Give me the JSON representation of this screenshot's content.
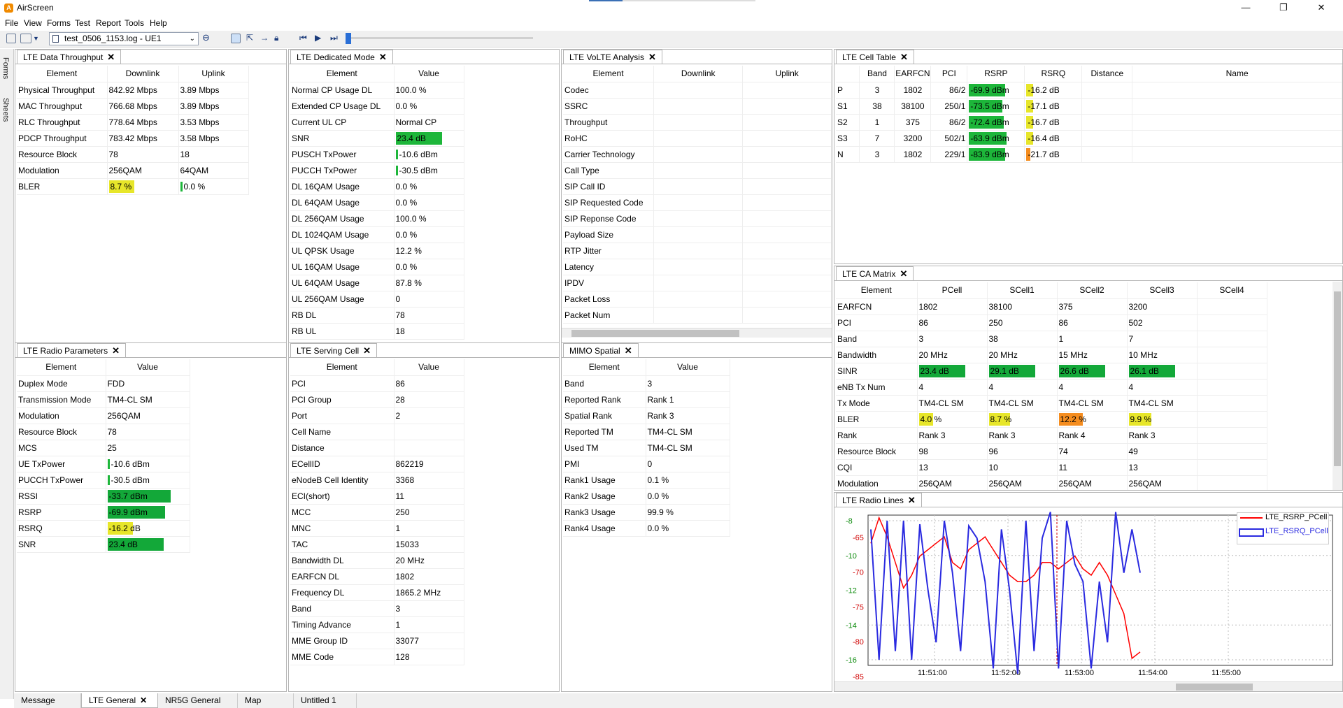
{
  "app": {
    "title": "AirScreen"
  },
  "window": {
    "minimize": "—",
    "restore": "❐",
    "close": "✕"
  },
  "menu": [
    "File",
    "View",
    "Forms",
    "Test",
    "Report",
    "Tools",
    "Help"
  ],
  "toolbar": {
    "log_file": "test_0506_1153.log - UE1"
  },
  "side_tabs": [
    "Forms",
    "Sheets"
  ],
  "panels": {
    "data_throughput": {
      "tab": "LTE Data Throughput",
      "headers": [
        "Element",
        "Downlink",
        "Uplink"
      ],
      "rows": [
        [
          "Physical Throughput",
          "842.92 Mbps",
          "3.89 Mbps"
        ],
        [
          "MAC Throughput",
          "766.68 Mbps",
          "3.89 Mbps"
        ],
        [
          "RLC Throughput",
          "778.64 Mbps",
          "3.53 Mbps"
        ],
        [
          "PDCP Throughput",
          "783.42 Mbps",
          "3.58 Mbps"
        ],
        [
          "Resource Block",
          "78",
          "18"
        ],
        [
          "Modulation",
          "256QAM",
          "64QAM"
        ],
        [
          "BLER",
          "8.7 %",
          "0.0 %"
        ]
      ]
    },
    "dedicated_mode": {
      "tab": "LTE Dedicated Mode",
      "headers": [
        "Element",
        "Value"
      ],
      "rows": [
        [
          "Normal CP Usage  DL",
          "100.0 %"
        ],
        [
          "Extended CP Usage DL",
          "0.0 %"
        ],
        [
          "Current UL CP",
          "Normal CP"
        ],
        [
          "SNR",
          "23.4 dB"
        ],
        [
          "PUSCH TxPower",
          "-10.6 dBm"
        ],
        [
          "PUCCH TxPower",
          "-30.5 dBm"
        ],
        [
          "DL 16QAM Usage",
          "0.0 %"
        ],
        [
          "DL 64QAM Usage",
          "0.0 %"
        ],
        [
          "DL 256QAM Usage",
          "100.0 %"
        ],
        [
          "DL 1024QAM Usage",
          "0.0 %"
        ],
        [
          "UL QPSK Usage",
          "12.2 %"
        ],
        [
          "UL 16QAM Usage",
          "0.0 %"
        ],
        [
          "UL 64QAM Usage",
          "87.8 %"
        ],
        [
          "UL 256QAM Usage",
          "0"
        ],
        [
          "RB DL",
          "78"
        ],
        [
          "RB UL",
          "18"
        ]
      ]
    },
    "volte": {
      "tab": "LTE VoLTE Analysis",
      "headers": [
        "Element",
        "Downlink",
        "Uplink"
      ],
      "rows": [
        "Codec",
        "SSRC",
        "Throughput",
        "RoHC",
        "Carrier Technology",
        "Call Type",
        "SIP Call ID",
        "SIP Requested Code",
        "SIP Reponse Code",
        "Payload Size",
        "RTP Jitter",
        "Latency",
        "IPDV",
        "Packet Loss",
        "Packet Num"
      ]
    },
    "cell_table": {
      "tab": "LTE Cell Table",
      "headers": [
        "",
        "Band",
        "EARFCN",
        "PCI",
        "RSRP",
        "RSRQ",
        "Distance",
        "Name"
      ],
      "rows": [
        [
          "P",
          "3",
          "1802",
          "86/2",
          "-69.9 dBm",
          "-16.2 dB"
        ],
        [
          "S1",
          "38",
          "38100",
          "250/1",
          "-73.5 dBm",
          "-17.1 dB"
        ],
        [
          "S2",
          "1",
          "375",
          "86/2",
          "-72.4 dBm",
          "-16.7 dB"
        ],
        [
          "S3",
          "7",
          "3200",
          "502/1",
          "-63.9 dBm",
          "-16.4 dB"
        ],
        [
          "N",
          "3",
          "1802",
          "229/1",
          "-83.9 dBm",
          "-21.7 dB"
        ]
      ]
    },
    "ca_matrix": {
      "tab": "LTE CA Matrix",
      "headers": [
        "Element",
        "PCell",
        "SCell1",
        "SCell2",
        "SCell3",
        "SCell4"
      ],
      "rows": [
        [
          "EARFCN",
          "1802",
          "38100",
          "375",
          "3200"
        ],
        [
          "PCI",
          "86",
          "250",
          "86",
          "502"
        ],
        [
          "Band",
          "3",
          "38",
          "1",
          "7"
        ],
        [
          "Bandwidth",
          "20 MHz",
          "20 MHz",
          "15 MHz",
          "10 MHz"
        ],
        [
          "SINR",
          "23.4 dB",
          "29.1 dB",
          "26.6 dB",
          "26.1 dB"
        ],
        [
          "eNB Tx Num",
          "4",
          "4",
          "4",
          "4"
        ],
        [
          "Tx Mode",
          "TM4-CL SM",
          "TM4-CL SM",
          "TM4-CL SM",
          "TM4-CL SM"
        ],
        [
          "BLER",
          "4.0 %",
          "8.7 %",
          "12.2 %",
          "9.9 %"
        ],
        [
          "Rank",
          "Rank 3",
          "Rank 3",
          "Rank 4",
          "Rank 3"
        ],
        [
          "Resource Block",
          "98",
          "96",
          "74",
          "49"
        ],
        [
          "CQI",
          "13",
          "10",
          "11",
          "13"
        ],
        [
          "Modulation",
          "256QAM",
          "256QAM",
          "256QAM",
          "256QAM"
        ]
      ]
    },
    "radio_params": {
      "tab": "LTE Radio Parameters",
      "headers": [
        "Element",
        "Value"
      ],
      "rows": [
        [
          "Duplex Mode",
          "FDD"
        ],
        [
          "Transmission Mode",
          "TM4-CL SM"
        ],
        [
          "Modulation",
          "256QAM"
        ],
        [
          "Resource Block",
          "78"
        ],
        [
          "MCS",
          "25"
        ],
        [
          "UE TxPower",
          "-10.6 dBm"
        ],
        [
          "PUCCH TxPower",
          "-30.5 dBm"
        ],
        [
          "RSSI",
          "-33.7 dBm"
        ],
        [
          "RSRP",
          "-69.9 dBm"
        ],
        [
          "RSRQ",
          "-16.2 dB"
        ],
        [
          "SNR",
          "23.4 dB"
        ]
      ]
    },
    "serving_cell": {
      "tab": "LTE Serving Cell",
      "headers": [
        "Element",
        "Value"
      ],
      "rows": [
        [
          "PCI",
          "86"
        ],
        [
          "PCI Group",
          "28"
        ],
        [
          "Port",
          "2"
        ],
        [
          "Cell Name",
          ""
        ],
        [
          "Distance",
          ""
        ],
        [
          "ECellID",
          "862219"
        ],
        [
          "eNodeB Cell Identity",
          "3368"
        ],
        [
          "ECI(short)",
          "11"
        ],
        [
          "MCC",
          "250"
        ],
        [
          "MNC",
          "1"
        ],
        [
          "TAC",
          "15033"
        ],
        [
          "Bandwidth DL",
          "20 MHz"
        ],
        [
          "EARFCN DL",
          "1802"
        ],
        [
          "Frequency DL",
          "1865.2 MHz"
        ],
        [
          "Band",
          "3"
        ],
        [
          "Timing Advance",
          "1"
        ],
        [
          "MME Group ID",
          "33077"
        ],
        [
          "MME Code",
          "128"
        ]
      ]
    },
    "mimo": {
      "tab": "MIMO Spatial",
      "headers": [
        "Element",
        "Value"
      ],
      "rows": [
        [
          "Band",
          "3"
        ],
        [
          "Reported Rank",
          "Rank 1"
        ],
        [
          "Spatial Rank",
          "Rank 3"
        ],
        [
          "Reported TM",
          "TM4-CL SM"
        ],
        [
          "Used TM",
          "TM4-CL SM"
        ],
        [
          "PMI",
          "0"
        ],
        [
          "Rank1 Usage",
          "0.1 %"
        ],
        [
          "Rank2 Usage",
          "0.0 %"
        ],
        [
          "Rank3 Usage",
          "99.9 %"
        ],
        [
          "Rank4 Usage",
          "0.0 %"
        ]
      ]
    },
    "radio_lines": {
      "tab": "LTE Radio Lines"
    }
  },
  "chart_data": {
    "type": "line",
    "x_ticks": [
      "11:51:00",
      "11:52:00",
      "11:53:00",
      "11:54:00",
      "11:55:00"
    ],
    "y_left_ticks": [
      "-8",
      "-10",
      "-12",
      "-14",
      "-16"
    ],
    "y_right_ticks": [
      "-65",
      "-70",
      "-75",
      "-80",
      "-85"
    ],
    "legend_position": "top-right",
    "series": [
      {
        "name": "LTE_RSRP_PCell",
        "color": "#ff0000",
        "axis": "right",
        "values": [
          -67,
          -63,
          -66,
          -70,
          -74,
          -72,
          -69,
          -68,
          -67,
          -66,
          -70,
          -71,
          -68,
          -67,
          -66,
          -68,
          -70,
          -72,
          -73,
          -73,
          -72,
          -70,
          -70,
          -71,
          -70,
          -69,
          -71,
          -72,
          -70,
          -72,
          -75,
          -78,
          -85,
          -84
        ]
      },
      {
        "name": "LTE_RSRQ_PCell",
        "color": "#2a2ae0",
        "axis": "left",
        "values": [
          -8.5,
          -16,
          -8,
          -15.5,
          -8,
          -16,
          -8.2,
          -12,
          -15,
          -8,
          -11,
          -15.5,
          -8.3,
          -9,
          -11.5,
          -16.5,
          -8.5,
          -12,
          -16.8,
          -8,
          -15.5,
          -9,
          -7.5,
          -16.5,
          -8,
          -10.5,
          -11.5,
          -16.5,
          -11.5,
          -15,
          -7.5,
          -11,
          -8.5,
          -11
        ]
      }
    ]
  },
  "bottom_tabs": [
    "Message",
    "LTE General",
    "NR5G General",
    "Map",
    "Untitled 1"
  ]
}
